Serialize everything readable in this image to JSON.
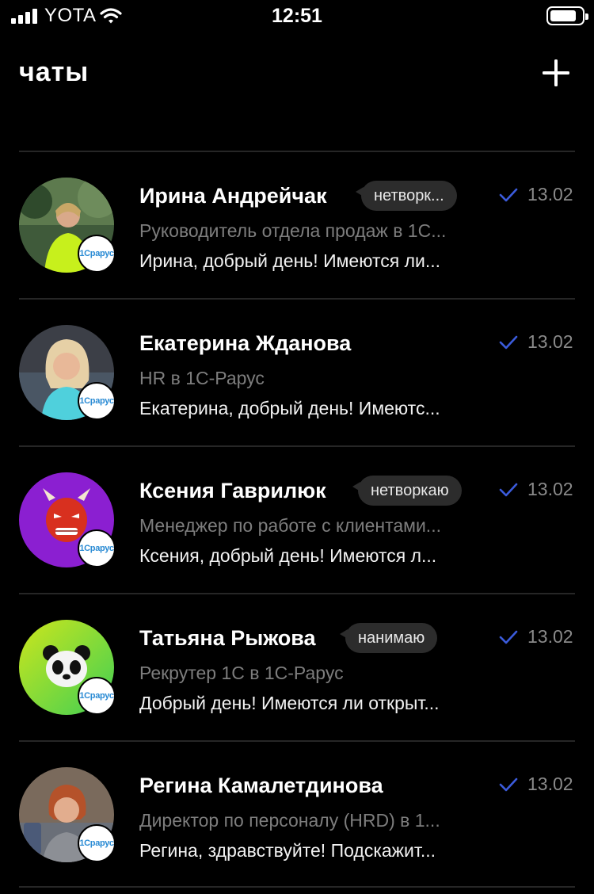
{
  "status_bar": {
    "carrier": "YOTA",
    "time": "12:51",
    "signal_icon": "signal-bars-icon",
    "wifi_icon": "wifi-icon",
    "battery_icon": "battery-icon"
  },
  "header": {
    "title": "чаты",
    "add_icon": "plus-icon"
  },
  "colors": {
    "background": "#000000",
    "divider": "#262626",
    "badge_bg": "#2c2c2c",
    "read_check": "#3b5bdb",
    "muted_text": "#7d7d7d"
  },
  "chats": [
    {
      "name": "Ирина Андрейчак",
      "tag": "нетворк...",
      "date": "13.02",
      "subtitle": "Руководитель отдела продаж в 1С...",
      "preview": "Ирина, добрый день! Имеются ли...",
      "company_badge": "1Срарус",
      "avatar_icon": "person-photo-avatar"
    },
    {
      "name": "Екатерина Жданова",
      "tag": "",
      "date": "13.02",
      "subtitle": "HR в 1С-Рарус",
      "preview": "Екатерина, добрый день! Имеютс...",
      "company_badge": "1Срарус",
      "avatar_icon": "person-photo-avatar"
    },
    {
      "name": "Ксения Гаврилюк",
      "tag": "нетворкаю",
      "date": "13.02",
      "subtitle": "Менеджер по работе с клиентами...",
      "preview": "Ксения, добрый день! Имеются л...",
      "company_badge": "1Срарус",
      "avatar_icon": "demon-mask-avatar"
    },
    {
      "name": "Татьяна Рыжова",
      "tag": "нанимаю",
      "date": "13.02",
      "subtitle": "Рекрутер 1С в 1С-Рарус",
      "preview": "Добрый день! Имеются ли открыт...",
      "company_badge": "1Срарус",
      "avatar_icon": "panda-avatar"
    },
    {
      "name": "Регина Камалетдинова",
      "tag": "",
      "date": "13.02",
      "subtitle": "Директор по персоналу (HRD) в 1...",
      "preview": "Регина, здравствуйте! Подскажит...",
      "company_badge": "1Срарус",
      "avatar_icon": "person-photo-avatar"
    }
  ]
}
